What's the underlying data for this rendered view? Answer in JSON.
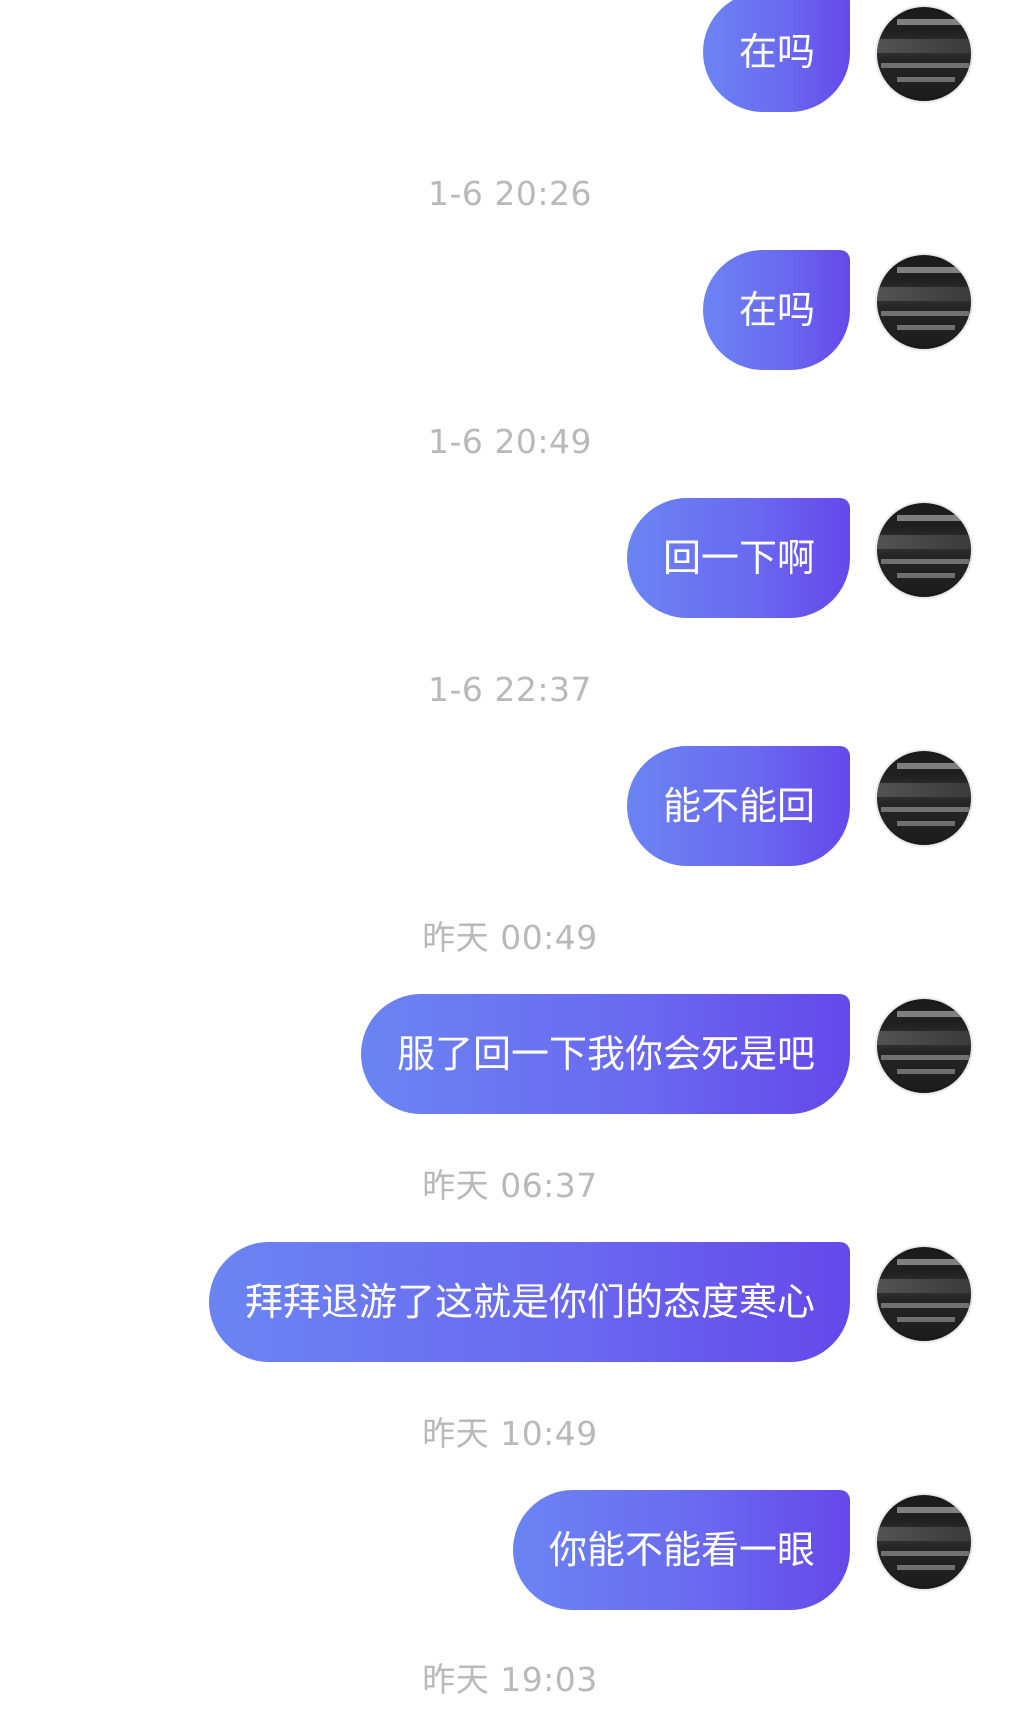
{
  "messages": [
    {
      "text": "在吗",
      "timestamp_after": "1-6 20:26"
    },
    {
      "text": "在吗",
      "timestamp_after": "1-6 20:49"
    },
    {
      "text": "回一下啊",
      "timestamp_after": "1-6 22:37"
    },
    {
      "text": "能不能回",
      "timestamp_after": "昨天 00:49"
    },
    {
      "text": "服了回一下我你会死是吧",
      "timestamp_after": "昨天 06:37"
    },
    {
      "text": "拜拜退游了这就是你们的态度寒心",
      "timestamp_after": "昨天 10:49"
    },
    {
      "text": "你能不能看一眼",
      "timestamp_after": "昨天 19:03"
    }
  ],
  "avatar": {
    "icon": "user-avatar-icon"
  },
  "colors": {
    "bubble_gradient_start": "#6b84f2",
    "bubble_gradient_end": "#6548ea",
    "timestamp_text": "#b9b9b9",
    "background": "#ffffff"
  }
}
